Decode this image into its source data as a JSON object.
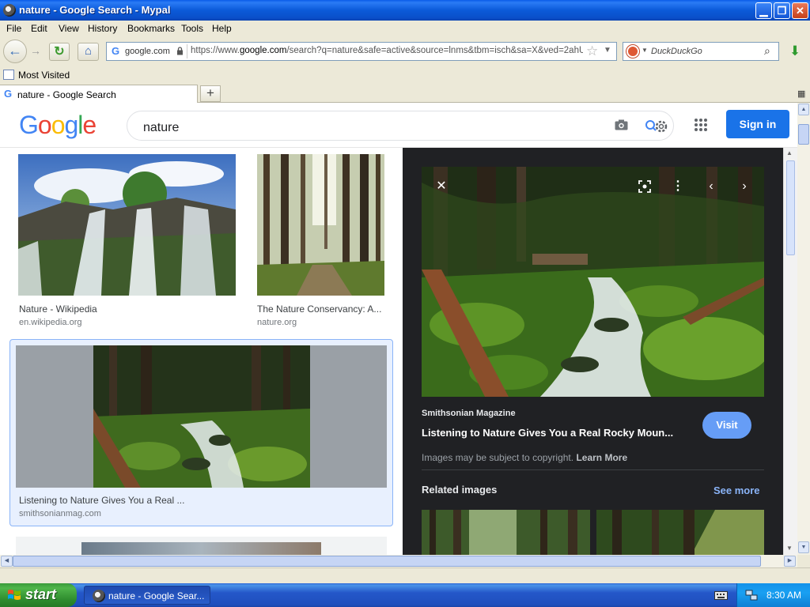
{
  "window": {
    "title": "nature - Google Search - Mypal",
    "min_label": "▁",
    "max_label": "❐",
    "close_label": "✕"
  },
  "menu": [
    "File",
    "Edit",
    "View",
    "History",
    "Bookmarks",
    "Tools",
    "Help"
  ],
  "nav": {
    "site_host": "google.com",
    "url_prefix": "https://www.",
    "url_domain": "google.com",
    "url_rest": "/search?q=nature&safe=active&source=lnms&tbm=isch&sa=X&ved=2ahUKE",
    "search_engine_placeholder": "DuckDuckGo"
  },
  "bookmarks": {
    "most_visited": "Most Visited"
  },
  "tabs": [
    {
      "title": "nature - Google Search"
    }
  ],
  "google": {
    "logo_letters": [
      {
        "ch": "G",
        "color": "#4285F4"
      },
      {
        "ch": "o",
        "color": "#EA4335"
      },
      {
        "ch": "o",
        "color": "#FBBC05"
      },
      {
        "ch": "g",
        "color": "#4285F4"
      },
      {
        "ch": "l",
        "color": "#34A853"
      },
      {
        "ch": "e",
        "color": "#EA4335"
      }
    ],
    "query": "nature",
    "signin_label": "Sign in"
  },
  "results": [
    {
      "title": "Nature - Wikipedia",
      "source": "en.wikipedia.org"
    },
    {
      "title": "The Nature Conservancy: A...",
      "source": "nature.org"
    },
    {
      "title": "Listening to Nature Gives You a Real ...",
      "source": "smithsonianmag.com"
    }
  ],
  "preview": {
    "source": "Smithsonian Magazine",
    "title": "Listening to Nature Gives You a Real Rocky Moun...",
    "visit_label": "Visit",
    "copyright_text": "Images may be subject to copyright.",
    "learn_more": "Learn More",
    "related_label": "Related images",
    "see_more": "See more"
  },
  "taskbar": {
    "start_label": "start",
    "task_label": "nature - Google Sear...",
    "clock": "8:30 AM"
  },
  "colors": {
    "google_blue": "#1a73e8",
    "preview_bg": "#202124",
    "selected_border": "#8ab4f8"
  }
}
